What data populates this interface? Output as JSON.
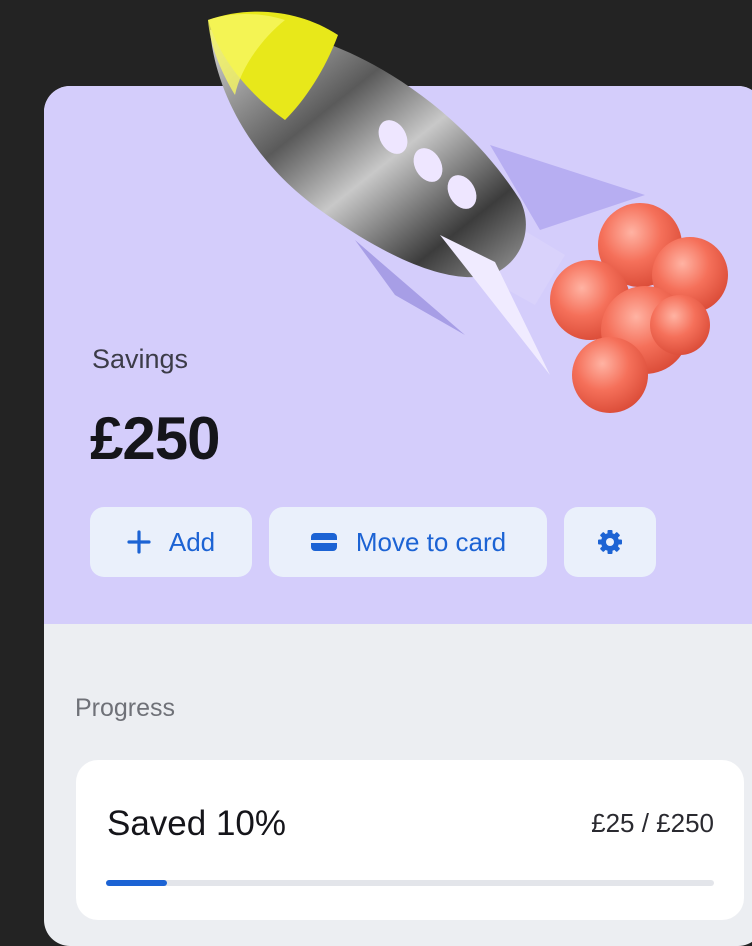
{
  "savings": {
    "label": "Savings",
    "amount": "£250"
  },
  "actions": {
    "add_label": "Add",
    "move_label": "Move to card",
    "add_icon": "plus-icon",
    "move_icon": "card-icon",
    "settings_icon": "gear-icon"
  },
  "progress": {
    "section_label": "Progress",
    "saved_text": "Saved 10%",
    "amount_text": "£25 / £250",
    "fraction": 0.1
  },
  "colors": {
    "hero_background": "#d4cdfb",
    "accent": "#1c63d4",
    "page_background": "#232323"
  }
}
